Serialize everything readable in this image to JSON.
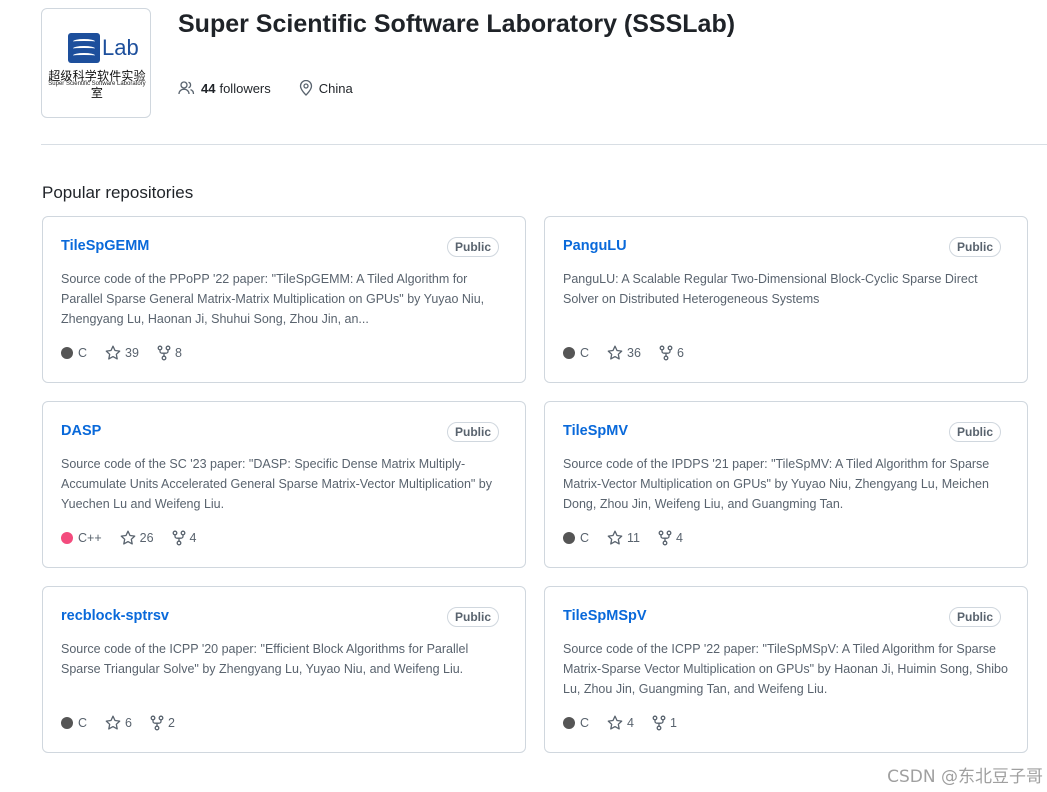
{
  "org": {
    "avatar_cn": "超级科学软件实验室",
    "avatar_en": "Super Scientific Software Laboratory",
    "avatar_lab": "Lab",
    "name": "Super Scientific Software Laboratory (SSSLab)",
    "followers_count": "44",
    "followers_label": "followers",
    "location": "China"
  },
  "section_title": "Popular repositories",
  "colors": {
    "link": "#0969da",
    "c_lang": "#555555",
    "cpp_lang": "#f34b7d"
  },
  "repos": [
    {
      "name": "TileSpGEMM",
      "visibility": "Public",
      "description": "Source code of the PPoPP '22 paper: \"TileSpGEMM: A Tiled Algorithm for Parallel Sparse General Matrix-Matrix Multiplication on GPUs\" by Yuyao Niu, Zhengyang Lu, Haonan Ji, Shuhui Song, Zhou Jin, an...",
      "language": "C",
      "stars": "39",
      "forks": "8"
    },
    {
      "name": "PanguLU",
      "visibility": "Public",
      "description": "PanguLU: A Scalable Regular Two-Dimensional Block-Cyclic Sparse Direct Solver on Distributed Heterogeneous Systems",
      "language": "C",
      "stars": "36",
      "forks": "6"
    },
    {
      "name": "DASP",
      "visibility": "Public",
      "description": "Source code of the SC '23 paper: \"DASP: Specific Dense Matrix Multiply-Accumulate Units Accelerated General Sparse Matrix-Vector Multiplication\" by Yuechen Lu and Weifeng Liu.",
      "language": "C++",
      "stars": "26",
      "forks": "4"
    },
    {
      "name": "TileSpMV",
      "visibility": "Public",
      "description": "Source code of the IPDPS '21 paper: \"TileSpMV: A Tiled Algorithm for Sparse Matrix-Vector Multiplication on GPUs\" by Yuyao Niu, Zhengyang Lu, Meichen Dong, Zhou Jin, Weifeng Liu, and Guangming Tan.",
      "language": "C",
      "stars": "11",
      "forks": "4"
    },
    {
      "name": "recblock-sptrsv",
      "visibility": "Public",
      "description": "Source code of the ICPP '20 paper: \"Efficient Block Algorithms for Parallel Sparse Triangular Solve\" by Zhengyang Lu, Yuyao Niu, and Weifeng Liu.",
      "language": "C",
      "stars": "6",
      "forks": "2"
    },
    {
      "name": "TileSpMSpV",
      "visibility": "Public",
      "description": "Source code of the ICPP '22 paper: \"TileSpMSpV: A Tiled Algorithm for Sparse Matrix-Sparse Vector Multiplication on GPUs\" by Haonan Ji, Huimin Song, Shibo Lu, Zhou Jin, Guangming Tan, and Weifeng Liu.",
      "language": "C",
      "stars": "4",
      "forks": "1"
    }
  ],
  "watermark": "CSDN @东北豆子哥"
}
